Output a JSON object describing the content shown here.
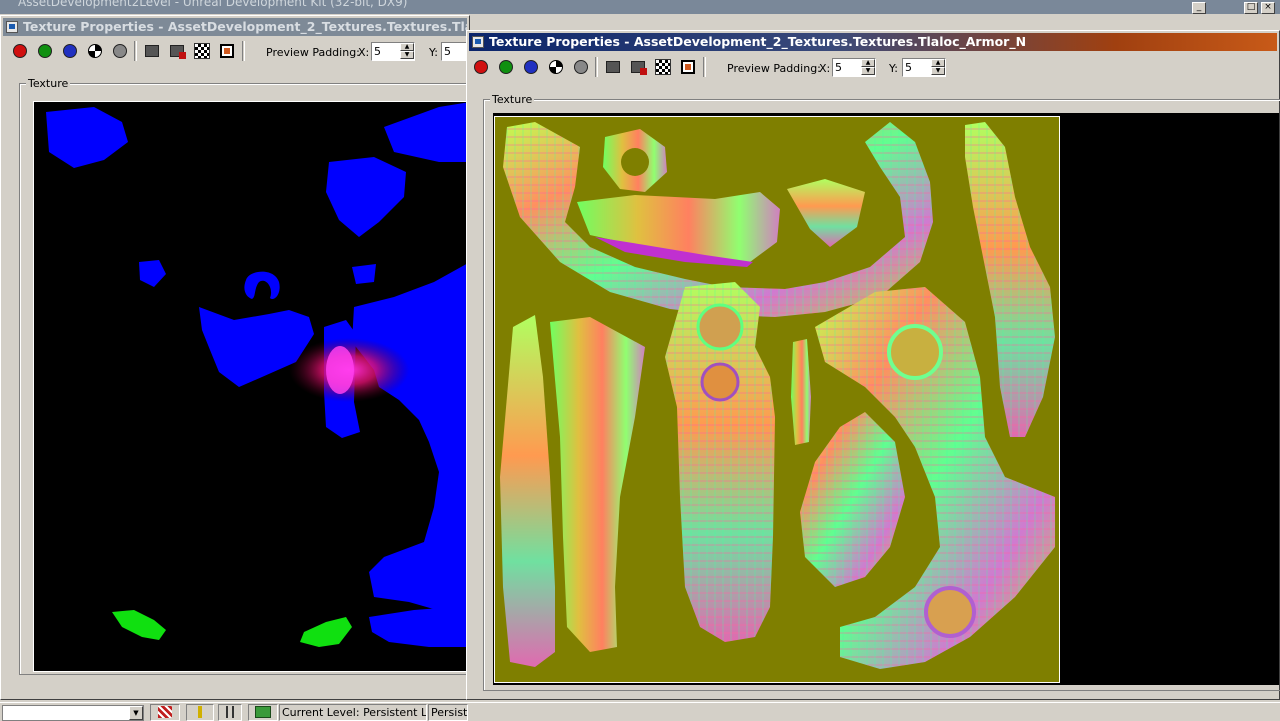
{
  "app": {
    "title": "AssetDevelopment2Level - Unreal Development Kit (32-bit, DX9)",
    "controls": [
      "_",
      "□",
      "×"
    ]
  },
  "back_window": {
    "title": "Texture Properties - AssetDevelopment_2_Textures.Textures.Tlaloc_M",
    "preview_padding_label": "Preview Padding:",
    "x_label": "X:",
    "x_value": "5",
    "y_label": "Y:",
    "y_value": "5",
    "group_label": "Texture",
    "texture_desc": "mask texture"
  },
  "front_window": {
    "title": "Texture Properties - AssetDevelopment_2_Textures.Textures.Tlaloc_Armor_N",
    "preview_padding_label": "Preview Padding:",
    "x_label": "X:",
    "x_value": "5",
    "y_label": "Y:",
    "y_value": "5",
    "group_label": "Texture",
    "texture_desc": "normal map texture"
  },
  "toolbar_icons": [
    "red-channel-icon",
    "green-channel-icon",
    "blue-channel-icon",
    "alpha-channel-icon",
    "gray-channel-icon",
    "monitor-icon",
    "monitor-red-icon",
    "checker-icon",
    "frame-icon"
  ],
  "colors": {
    "mask_blue": "#0000ff",
    "mask_green": "#00ff00",
    "mask_magenta": "#ff20c0",
    "normal_bg": "#7f7f00",
    "title_active_left": "#0a246a",
    "title_active_right": "#c85a18",
    "title_inactive": "#7e8a97"
  },
  "statusbar": {
    "current_level_label": "Current Level:",
    "current_level_value": "Persistent Leve",
    "persistent_text": "Persistent"
  }
}
